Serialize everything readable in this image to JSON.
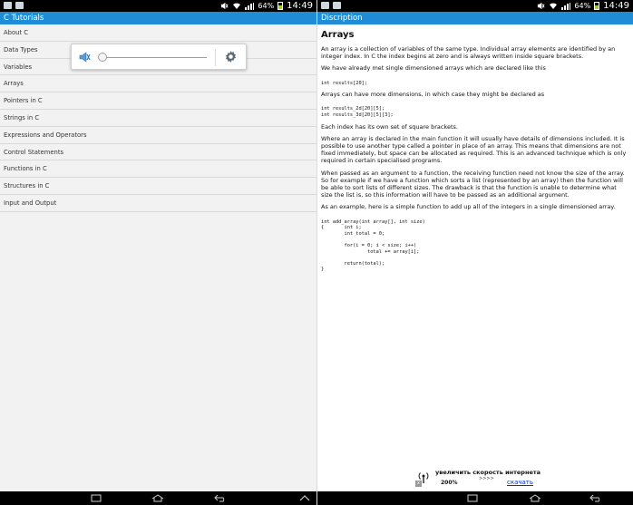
{
  "status": {
    "battery_text": "64%",
    "time": "14:49"
  },
  "left": {
    "title": "C Tutorials",
    "topics": [
      "About C",
      "Data Types",
      "Variables",
      "Arrays",
      "Pointers in C",
      "Strings in C",
      "Expressions and Operators",
      "Control Statements",
      "Functions in C",
      "Structures in C",
      "Input and Output"
    ],
    "volume_level": 0
  },
  "right": {
    "title": "Discription",
    "heading": "Arrays",
    "p1": "An array is a collection of variables of the same type. Individual array elements are identified by an integer index. In C the index begins at zero and is always written inside square brackets.",
    "p2": "We have already met single dimensioned arrays which are declared like this",
    "code1": "int results[20];",
    "p3": "Arrays can have more dimensions, in which case they might be declared as",
    "code2": "int results_2d[20][5];\nint results_3d[20][5][3];",
    "p4": "Each index has its own set of square brackets.",
    "p5": "Where an array is declared in the main function it will usually have details of dimensions included. It is possible to use another type called a pointer in place of an array. This means that dimensions are not fixed immediately, but space can be allocated as required. This is an advanced technique which is only required in certain specialised programs.",
    "p6": "When passed as an argument to a function, the receiving function need not know the size of the array. So for example if we have a function which sorts a list (represented by an array) then the function will be able to sort lists of different sizes. The drawback is that the function is unable to determine what size the list is, so this information will have to be passed as an additional argument.",
    "p7": "As an example, here is a simple function to add up all of the integers in a single dimensioned array.",
    "code3": "int add_array(int array[], int size)\n{       int i;\n        int total = 0;\n\n        for(i = 0; i < size; i++)\n                total += array[i];\n\n        return(total);\n}",
    "ad": {
      "headline": "увеличить скорость интернета",
      "percent": "200%",
      "arrows": ">>>>",
      "link": "скачать",
      "close": "x"
    }
  },
  "colors": {
    "title_bar": "#1f8dd6",
    "status_bar": "#000000",
    "list_bg": "#f2f2f2"
  }
}
